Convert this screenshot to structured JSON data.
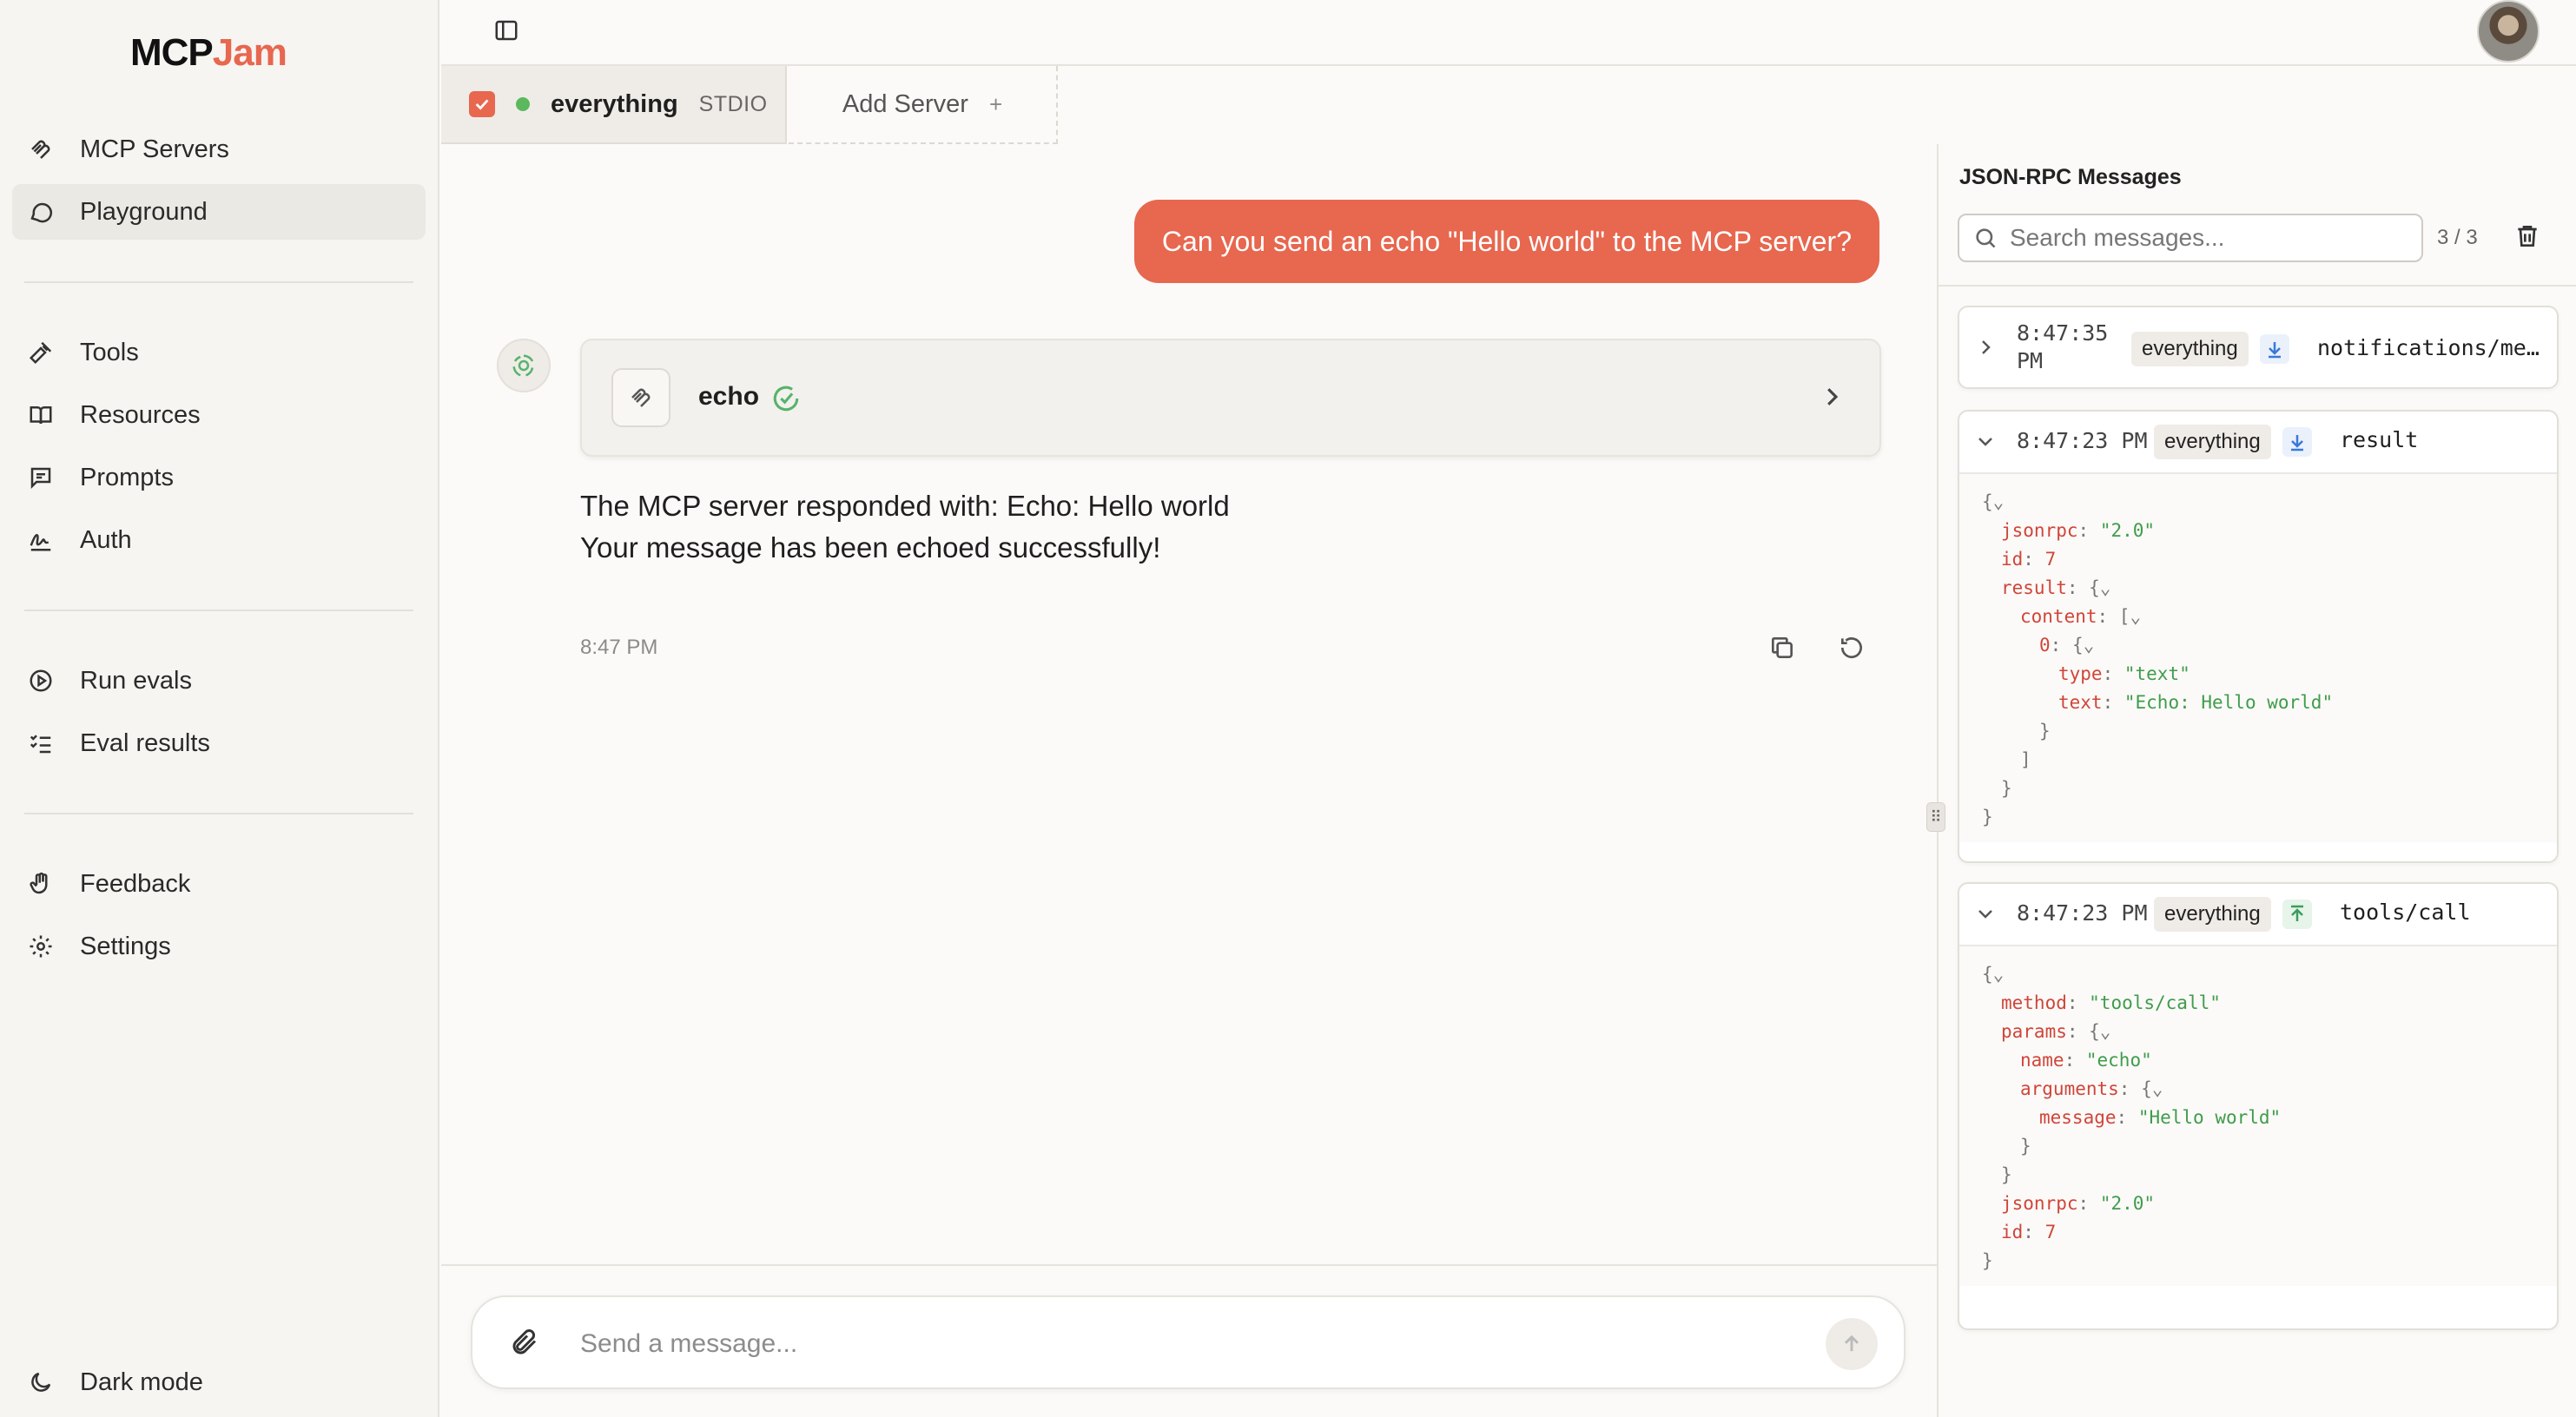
{
  "app": {
    "logo_part1": "MCP",
    "logo_part2": "Jam"
  },
  "sidebar": {
    "items": [
      {
        "label": "MCP Servers",
        "icon": "mcp-icon"
      },
      {
        "label": "Playground",
        "icon": "chat-bubble-icon",
        "active": true
      },
      {
        "label": "Tools",
        "icon": "hammer-icon"
      },
      {
        "label": "Resources",
        "icon": "book-icon"
      },
      {
        "label": "Prompts",
        "icon": "message-square-icon"
      },
      {
        "label": "Auth",
        "icon": "signature-icon"
      },
      {
        "label": "Run evals",
        "icon": "play-circle-icon"
      },
      {
        "label": "Eval results",
        "icon": "list-checks-icon"
      },
      {
        "label": "Feedback",
        "icon": "hand-icon"
      },
      {
        "label": "Settings",
        "icon": "gear-icon"
      }
    ],
    "dark_mode_label": "Dark mode"
  },
  "servers": {
    "active": {
      "name": "everything",
      "transport": "STDIO",
      "checked": true,
      "status": "connected"
    },
    "add_label": "Add Server",
    "add_icon": "+"
  },
  "chat": {
    "user_message": "Can you send an echo \"Hello world\" to the MCP server?",
    "tool_call": {
      "name": "echo",
      "status": "success"
    },
    "response_lines": [
      "The MCP server responded with: Echo: Hello world",
      "Your message has been echoed successfully!"
    ],
    "time": "8:47 PM",
    "composer_placeholder": "Send a message..."
  },
  "json_panel": {
    "title": "JSON-RPC Messages",
    "search_placeholder": "Search messages...",
    "count": "3 / 3",
    "messages": [
      {
        "time_line1": "8:47:35",
        "time_line2": "PM",
        "server": "everything",
        "direction": "incoming",
        "method": "notifications/me…",
        "expanded": false
      },
      {
        "time": "8:47:23 PM",
        "server": "everything",
        "direction": "incoming",
        "method": "result",
        "expanded": true
      },
      {
        "time": "8:47:23 PM",
        "server": "everything",
        "direction": "outgoing",
        "method": "tools/call",
        "expanded": true
      }
    ]
  },
  "colors": {
    "accent": "#e7674f",
    "status_connected": "#5cb85c",
    "json_key": "#d0453a",
    "json_string": "#3f9c4b"
  }
}
